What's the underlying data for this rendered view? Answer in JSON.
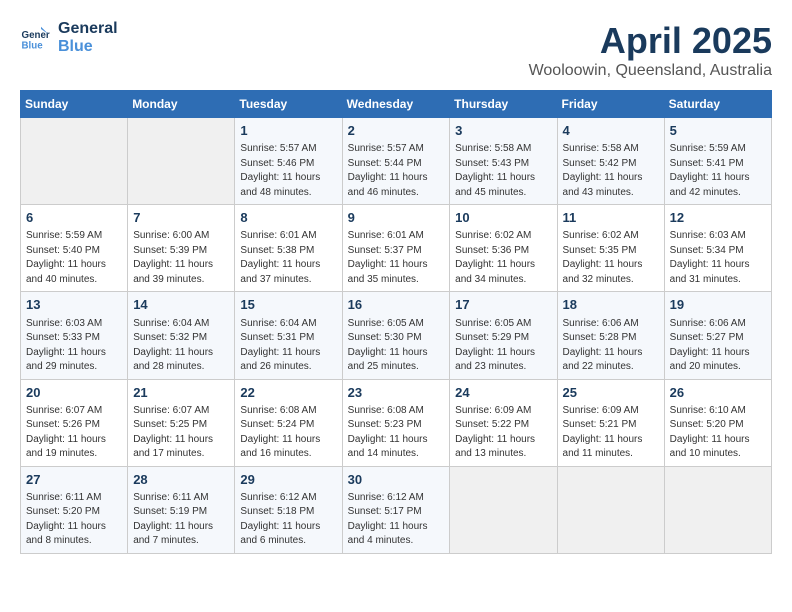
{
  "header": {
    "logo_line1": "General",
    "logo_line2": "Blue",
    "month": "April 2025",
    "location": "Wooloowin, Queensland, Australia"
  },
  "weekdays": [
    "Sunday",
    "Monday",
    "Tuesday",
    "Wednesday",
    "Thursday",
    "Friday",
    "Saturday"
  ],
  "weeks": [
    [
      {
        "day": "",
        "sunrise": "",
        "sunset": "",
        "daylight": ""
      },
      {
        "day": "",
        "sunrise": "",
        "sunset": "",
        "daylight": ""
      },
      {
        "day": "1",
        "sunrise": "Sunrise: 5:57 AM",
        "sunset": "Sunset: 5:46 PM",
        "daylight": "Daylight: 11 hours and 48 minutes."
      },
      {
        "day": "2",
        "sunrise": "Sunrise: 5:57 AM",
        "sunset": "Sunset: 5:44 PM",
        "daylight": "Daylight: 11 hours and 46 minutes."
      },
      {
        "day": "3",
        "sunrise": "Sunrise: 5:58 AM",
        "sunset": "Sunset: 5:43 PM",
        "daylight": "Daylight: 11 hours and 45 minutes."
      },
      {
        "day": "4",
        "sunrise": "Sunrise: 5:58 AM",
        "sunset": "Sunset: 5:42 PM",
        "daylight": "Daylight: 11 hours and 43 minutes."
      },
      {
        "day": "5",
        "sunrise": "Sunrise: 5:59 AM",
        "sunset": "Sunset: 5:41 PM",
        "daylight": "Daylight: 11 hours and 42 minutes."
      }
    ],
    [
      {
        "day": "6",
        "sunrise": "Sunrise: 5:59 AM",
        "sunset": "Sunset: 5:40 PM",
        "daylight": "Daylight: 11 hours and 40 minutes."
      },
      {
        "day": "7",
        "sunrise": "Sunrise: 6:00 AM",
        "sunset": "Sunset: 5:39 PM",
        "daylight": "Daylight: 11 hours and 39 minutes."
      },
      {
        "day": "8",
        "sunrise": "Sunrise: 6:01 AM",
        "sunset": "Sunset: 5:38 PM",
        "daylight": "Daylight: 11 hours and 37 minutes."
      },
      {
        "day": "9",
        "sunrise": "Sunrise: 6:01 AM",
        "sunset": "Sunset: 5:37 PM",
        "daylight": "Daylight: 11 hours and 35 minutes."
      },
      {
        "day": "10",
        "sunrise": "Sunrise: 6:02 AM",
        "sunset": "Sunset: 5:36 PM",
        "daylight": "Daylight: 11 hours and 34 minutes."
      },
      {
        "day": "11",
        "sunrise": "Sunrise: 6:02 AM",
        "sunset": "Sunset: 5:35 PM",
        "daylight": "Daylight: 11 hours and 32 minutes."
      },
      {
        "day": "12",
        "sunrise": "Sunrise: 6:03 AM",
        "sunset": "Sunset: 5:34 PM",
        "daylight": "Daylight: 11 hours and 31 minutes."
      }
    ],
    [
      {
        "day": "13",
        "sunrise": "Sunrise: 6:03 AM",
        "sunset": "Sunset: 5:33 PM",
        "daylight": "Daylight: 11 hours and 29 minutes."
      },
      {
        "day": "14",
        "sunrise": "Sunrise: 6:04 AM",
        "sunset": "Sunset: 5:32 PM",
        "daylight": "Daylight: 11 hours and 28 minutes."
      },
      {
        "day": "15",
        "sunrise": "Sunrise: 6:04 AM",
        "sunset": "Sunset: 5:31 PM",
        "daylight": "Daylight: 11 hours and 26 minutes."
      },
      {
        "day": "16",
        "sunrise": "Sunrise: 6:05 AM",
        "sunset": "Sunset: 5:30 PM",
        "daylight": "Daylight: 11 hours and 25 minutes."
      },
      {
        "day": "17",
        "sunrise": "Sunrise: 6:05 AM",
        "sunset": "Sunset: 5:29 PM",
        "daylight": "Daylight: 11 hours and 23 minutes."
      },
      {
        "day": "18",
        "sunrise": "Sunrise: 6:06 AM",
        "sunset": "Sunset: 5:28 PM",
        "daylight": "Daylight: 11 hours and 22 minutes."
      },
      {
        "day": "19",
        "sunrise": "Sunrise: 6:06 AM",
        "sunset": "Sunset: 5:27 PM",
        "daylight": "Daylight: 11 hours and 20 minutes."
      }
    ],
    [
      {
        "day": "20",
        "sunrise": "Sunrise: 6:07 AM",
        "sunset": "Sunset: 5:26 PM",
        "daylight": "Daylight: 11 hours and 19 minutes."
      },
      {
        "day": "21",
        "sunrise": "Sunrise: 6:07 AM",
        "sunset": "Sunset: 5:25 PM",
        "daylight": "Daylight: 11 hours and 17 minutes."
      },
      {
        "day": "22",
        "sunrise": "Sunrise: 6:08 AM",
        "sunset": "Sunset: 5:24 PM",
        "daylight": "Daylight: 11 hours and 16 minutes."
      },
      {
        "day": "23",
        "sunrise": "Sunrise: 6:08 AM",
        "sunset": "Sunset: 5:23 PM",
        "daylight": "Daylight: 11 hours and 14 minutes."
      },
      {
        "day": "24",
        "sunrise": "Sunrise: 6:09 AM",
        "sunset": "Sunset: 5:22 PM",
        "daylight": "Daylight: 11 hours and 13 minutes."
      },
      {
        "day": "25",
        "sunrise": "Sunrise: 6:09 AM",
        "sunset": "Sunset: 5:21 PM",
        "daylight": "Daylight: 11 hours and 11 minutes."
      },
      {
        "day": "26",
        "sunrise": "Sunrise: 6:10 AM",
        "sunset": "Sunset: 5:20 PM",
        "daylight": "Daylight: 11 hours and 10 minutes."
      }
    ],
    [
      {
        "day": "27",
        "sunrise": "Sunrise: 6:11 AM",
        "sunset": "Sunset: 5:20 PM",
        "daylight": "Daylight: 11 hours and 8 minutes."
      },
      {
        "day": "28",
        "sunrise": "Sunrise: 6:11 AM",
        "sunset": "Sunset: 5:19 PM",
        "daylight": "Daylight: 11 hours and 7 minutes."
      },
      {
        "day": "29",
        "sunrise": "Sunrise: 6:12 AM",
        "sunset": "Sunset: 5:18 PM",
        "daylight": "Daylight: 11 hours and 6 minutes."
      },
      {
        "day": "30",
        "sunrise": "Sunrise: 6:12 AM",
        "sunset": "Sunset: 5:17 PM",
        "daylight": "Daylight: 11 hours and 4 minutes."
      },
      {
        "day": "",
        "sunrise": "",
        "sunset": "",
        "daylight": ""
      },
      {
        "day": "",
        "sunrise": "",
        "sunset": "",
        "daylight": ""
      },
      {
        "day": "",
        "sunrise": "",
        "sunset": "",
        "daylight": ""
      }
    ]
  ]
}
